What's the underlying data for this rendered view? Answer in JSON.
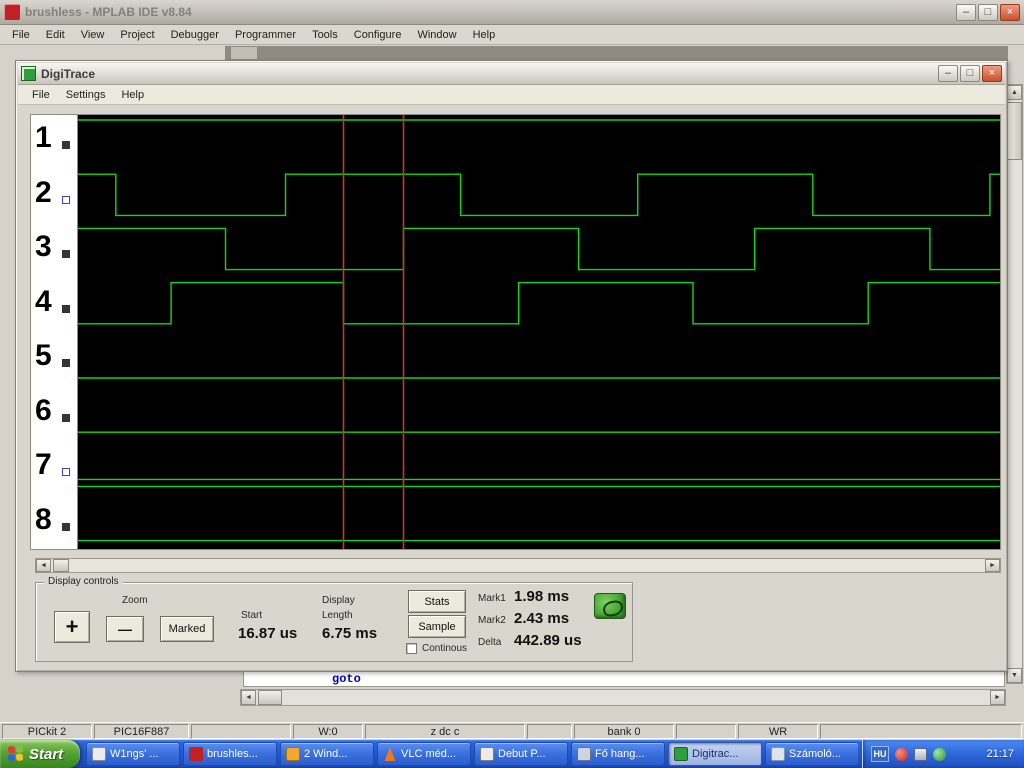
{
  "icons": {
    "minimize": "–",
    "maximize": "□",
    "close": "×",
    "up": "▲",
    "down": "▼",
    "left": "◄",
    "right": "►"
  },
  "main_window": {
    "title": "brushless - MPLAB IDE v8.84",
    "menu": [
      "File",
      "Edit",
      "View",
      "Project",
      "Debugger",
      "Programmer",
      "Tools",
      "Configure",
      "Window",
      "Help"
    ],
    "status_segments": [
      "PICkit 2",
      "PIC16F887",
      "",
      "W:0",
      "z dc c",
      "",
      "bank 0",
      "",
      "WR",
      ""
    ]
  },
  "digitrace": {
    "title": "DigiTrace",
    "menu": [
      "File",
      "Settings",
      "Help"
    ],
    "waveform": {
      "type": "logic-trace",
      "channels": [
        {
          "label": "1",
          "box": "filled",
          "level_start": 1,
          "transitions": []
        },
        {
          "label": "2",
          "box": "open",
          "level_start": 1,
          "transitions": [
            0.041,
            0.225,
            0.415,
            0.607,
            0.797,
            0.989
          ]
        },
        {
          "label": "3",
          "box": "filled",
          "level_start": 1,
          "transitions": [
            0.16,
            0.353,
            0.543,
            0.734,
            0.924
          ]
        },
        {
          "label": "4",
          "box": "filled",
          "level_start": 0,
          "transitions": [
            0.101,
            0.288,
            0.478,
            0.667,
            0.857
          ]
        },
        {
          "label": "5",
          "box": "filled",
          "level_start": 0,
          "transitions": []
        },
        {
          "label": "6",
          "box": "filled",
          "level_start": 0,
          "transitions": []
        },
        {
          "label": "7",
          "box": "open",
          "level_start": 0,
          "transitions": [],
          "double_line": true
        },
        {
          "label": "8",
          "box": "filled",
          "level_start": 0,
          "transitions": []
        }
      ],
      "cursors": [
        0.288,
        0.353
      ],
      "colors": {
        "trace": "#14d614",
        "cursor": "#c8382a",
        "background": "#000000"
      }
    },
    "controls": {
      "group_label": "Display controls",
      "zoom_label": "Zoom",
      "zoom_in_label": "+",
      "zoom_out_label": "—",
      "marked_label": "Marked",
      "start_label": "Start",
      "start_value": "16.87 us",
      "length_label_line1": "Display",
      "length_label_line2": "Length",
      "length_value": "6.75 ms",
      "stats_label": "Stats",
      "sample_label": "Sample",
      "continous_label": "Continous",
      "mark1_label": "Mark1",
      "mark1_value": "1.98 ms",
      "mark2_label": "Mark2",
      "mark2_value": "2.43 ms",
      "delta_label": "Delta",
      "delta_value": "442.89 us"
    }
  },
  "editor": {
    "visible_code": "goto"
  },
  "taskbar": {
    "start_label": "Start",
    "buttons": [
      {
        "label": "W1ngs' ...",
        "icon": "document-icon",
        "active": false
      },
      {
        "label": "brushles...",
        "icon": "mplab-icon",
        "active": false
      },
      {
        "label": "2 Wind...",
        "icon": "folder-icon",
        "active": false
      },
      {
        "label": "VLC méd...",
        "icon": "vlc-cone-icon",
        "active": false
      },
      {
        "label": "Debut P...",
        "icon": "debut-icon",
        "active": false
      },
      {
        "label": "Fő hang...",
        "icon": "speaker-icon",
        "active": false
      },
      {
        "label": "Digitrac...",
        "icon": "digitrace-tbicon",
        "active": true
      },
      {
        "label": "Számoló...",
        "icon": "calculator-icon",
        "active": false
      }
    ],
    "tray": {
      "language": "HU",
      "time": "21:17"
    }
  }
}
